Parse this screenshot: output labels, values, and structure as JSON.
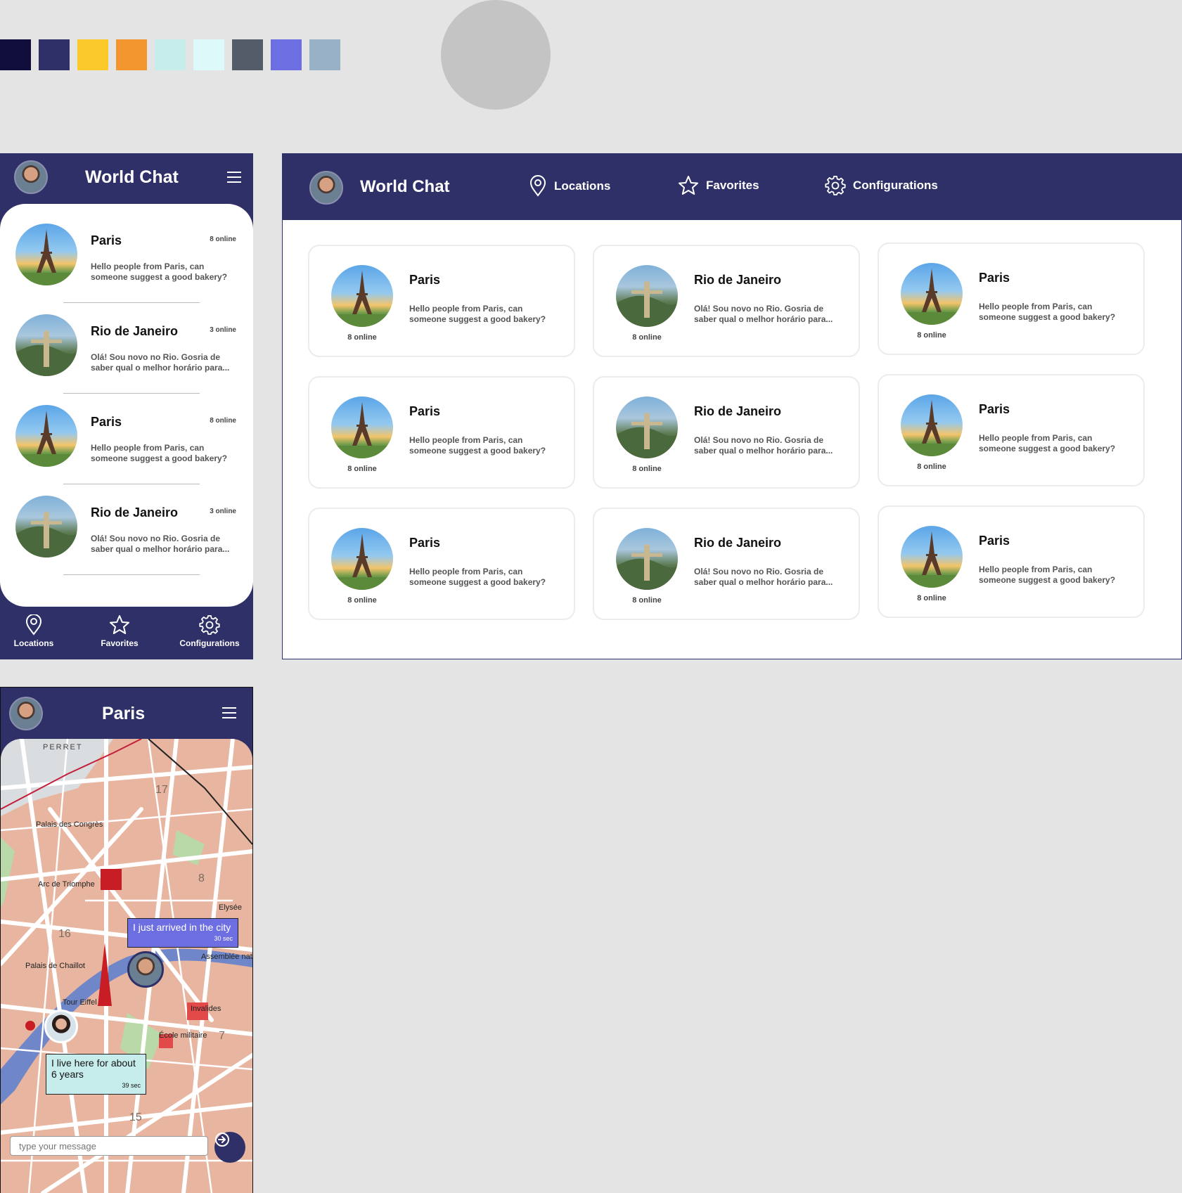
{
  "palette": [
    "#110e3c",
    "#2e3067",
    "#fbc92a",
    "#f2962d",
    "#c7ecec",
    "#def9f9",
    "#555c69",
    "#6e6ee3",
    "#99b1c6"
  ],
  "app": {
    "title": "World Chat"
  },
  "nav": {
    "locations": "Locations",
    "favorites": "Favorites",
    "configurations": "Configurations"
  },
  "mobile_list": [
    {
      "name": "Paris",
      "online": "8 online",
      "message": "Hello people from Paris, can someone suggest a good bakery?",
      "photo": "paris"
    },
    {
      "name": "Rio de Janeiro",
      "online": "3 online",
      "message": "Olá! Sou novo no Rio. Gosria de saber qual o melhor horário para...",
      "photo": "rio"
    },
    {
      "name": "Paris",
      "online": "8 online",
      "message": "Hello people from Paris, can someone suggest a good bakery?",
      "photo": "paris"
    },
    {
      "name": "Rio de Janeiro",
      "online": "3 online",
      "message": "Olá! Sou novo no Rio. Gosria de saber qual o melhor horário para...",
      "photo": "rio"
    }
  ],
  "desktop_cards": [
    {
      "name": "Paris",
      "online": "8 online",
      "message": "Hello people from Paris, can someone suggest a good bakery?",
      "photo": "paris"
    },
    {
      "name": "Rio de Janeiro",
      "online": "8 online",
      "message": "Olá! Sou novo no Rio. Gosria de saber qual o melhor horário para...",
      "photo": "rio"
    },
    {
      "name": "Paris",
      "online": "8 online",
      "message": "Hello people from Paris, can someone suggest a good bakery?",
      "photo": "paris"
    },
    {
      "name": "Paris",
      "online": "8 online",
      "message": "Hello people from Paris, can someone suggest a good bakery?",
      "photo": "paris"
    },
    {
      "name": "Rio de Janeiro",
      "online": "8 online",
      "message": "Olá! Sou novo no Rio. Gosria de saber qual o melhor horário para...",
      "photo": "rio"
    },
    {
      "name": "Paris",
      "online": "8 online",
      "message": "Hello people from Paris, can someone suggest a good bakery?",
      "photo": "paris"
    },
    {
      "name": "Paris",
      "online": "8 online",
      "message": "Hello people from Paris, can someone suggest a good bakery?",
      "photo": "paris"
    },
    {
      "name": "Rio de Janeiro",
      "online": "8 online",
      "message": "Olá! Sou novo no Rio. Gosria de saber qual o melhor horário para...",
      "photo": "rio"
    },
    {
      "name": "Paris",
      "online": "8 online",
      "message": "Hello people from Paris, can someone suggest a good bakery?",
      "photo": "paris"
    }
  ],
  "map_screen": {
    "title": "Paris",
    "bubble_1": {
      "text": "I just arrived in the city",
      "time": "30 sec"
    },
    "bubble_2": {
      "text": "I live here for about 6 years",
      "time": "39 sec"
    },
    "input_placeholder": "type your message",
    "labels": [
      "PERRET",
      "Palais des Congrès",
      "Arc de Triomphe",
      "Palais de Chaillot",
      "Tour Eiffel",
      "Invalides",
      "Assemblée nationale",
      "École militaire",
      "Elysée",
      "17",
      "16",
      "15",
      "8",
      "7"
    ]
  }
}
